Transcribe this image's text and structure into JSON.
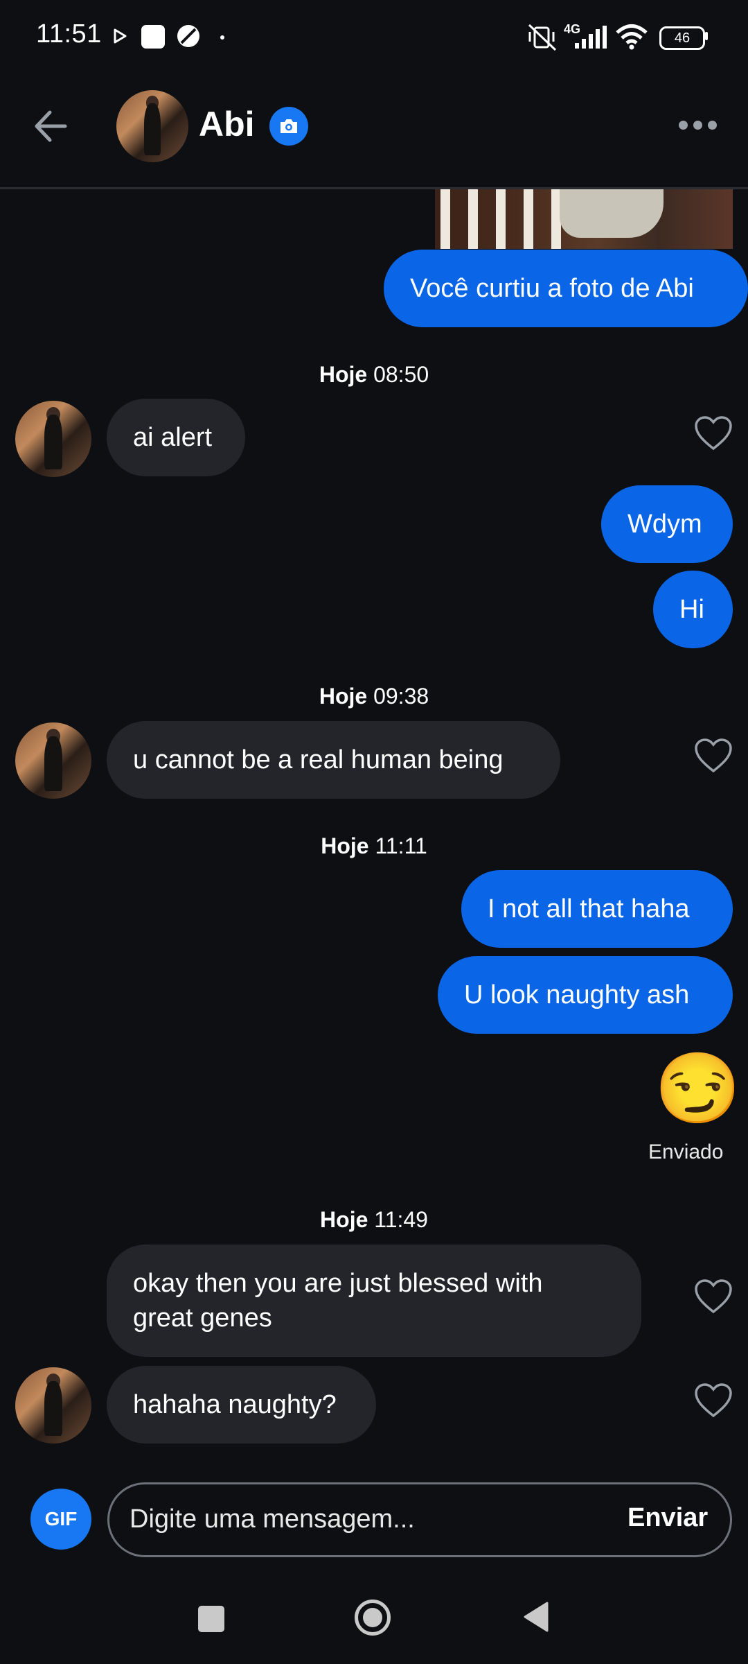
{
  "status_bar": {
    "time": "11:51",
    "network": "4G",
    "battery": "46"
  },
  "header": {
    "title": "Abi",
    "icons": [
      "back-arrow-icon",
      "camera-icon",
      "more-icon"
    ]
  },
  "messages": [
    {
      "type": "sent",
      "text": "Você curtiu a foto de Abi"
    },
    {
      "type": "timestamp",
      "day": "Hoje",
      "time": "08:50"
    },
    {
      "type": "received",
      "text": "ai alert"
    },
    {
      "type": "sent",
      "text": "Wdym"
    },
    {
      "type": "sent",
      "text": "Hi"
    },
    {
      "type": "timestamp",
      "day": "Hoje",
      "time": "09:38"
    },
    {
      "type": "received",
      "text": "u cannot be a real human being"
    },
    {
      "type": "timestamp",
      "day": "Hoje",
      "time": "11:11"
    },
    {
      "type": "sent",
      "text": "I not all that haha"
    },
    {
      "type": "sent",
      "text": "U look naughty ash"
    },
    {
      "type": "sent",
      "text": "😏"
    },
    {
      "type": "status",
      "text": "Enviado"
    },
    {
      "type": "timestamp",
      "day": "Hoje",
      "time": "11:49"
    },
    {
      "type": "received",
      "text": "okay then you are just blessed with great genes"
    },
    {
      "type": "received",
      "text": "hahaha naughty?"
    }
  ],
  "composer": {
    "gif_label": "GIF",
    "placeholder": "Digite uma mensagem...",
    "send_label": "Enviar"
  },
  "colors": {
    "background": "#0e0f12",
    "sent_bubble": "#0a66e6",
    "received_bubble": "#24252a",
    "accent": "#1877f2"
  }
}
